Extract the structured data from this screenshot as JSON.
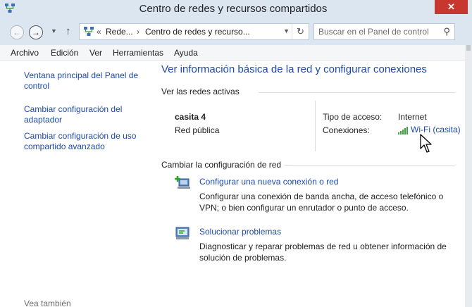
{
  "window": {
    "title": "Centro de redes y recursos compartidos",
    "close_label": "✕"
  },
  "navigation": {
    "back_icon": "back-arrow-icon",
    "forward_icon": "forward-arrow-icon",
    "up_icon": "up-arrow-icon",
    "address": {
      "prefix": "«",
      "segments": [
        "Rede...",
        "Centro de redes y recurso..."
      ],
      "separator": "›"
    },
    "search_placeholder": "Buscar en el Panel de control"
  },
  "menu": {
    "items": [
      "Archivo",
      "Edición",
      "Ver",
      "Herramientas",
      "Ayuda"
    ]
  },
  "left_pane": {
    "links": [
      "Ventana principal del Panel de control",
      "Cambiar configuración del adaptador",
      "Cambiar configuración de uso compartido avanzado"
    ],
    "see_also": "Vea también"
  },
  "main": {
    "title": "Ver información básica de la red y configurar conexiones",
    "active_networks_heading": "Ver las redes activas",
    "network": {
      "name": "casita  4",
      "type": "Red pública",
      "access_label": "Tipo de acceso:",
      "access_value": "Internet",
      "connections_label": "Conexiones:",
      "connection_value": "Wi-Fi (casita)"
    },
    "change_heading": "Cambiar la configuración de red",
    "tasks": [
      {
        "title": "Configurar una nueva conexión o red",
        "description": "Configurar una conexión de banda ancha, de acceso telefónico o VPN; o bien configurar un enrutador o punto de acceso."
      },
      {
        "title": "Solucionar problemas",
        "description": "Diagnosticar y reparar problemas de red u obtener información de solución de problemas."
      }
    ]
  },
  "colors": {
    "link": "#1d4aa8",
    "titlebar": "#dce6f1",
    "close": "#c7372f",
    "signal": "#3aa23a"
  }
}
